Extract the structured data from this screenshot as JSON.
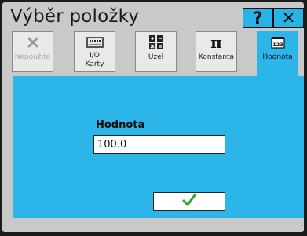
{
  "window": {
    "title": "Výběr položky",
    "help_label": "?",
    "close_label": "✕"
  },
  "tabs": [
    {
      "label": "Nepoužito",
      "icon": "x-icon",
      "state": "disabled"
    },
    {
      "label": "I/O\nKarty",
      "icon": "io-card-icon",
      "state": "normal"
    },
    {
      "label": "Uzel",
      "icon": "node-grid-icon",
      "state": "normal"
    },
    {
      "label": "Konstanta",
      "icon": "pi-icon",
      "state": "normal"
    },
    {
      "label": "Hodnota",
      "icon": "number-123-icon",
      "state": "active"
    }
  ],
  "form": {
    "value_label": "Hodnota",
    "value": "100.0",
    "ok_icon": "checkmark-icon"
  },
  "colors": {
    "accent": "#2bb5e8",
    "check": "#2fa82f"
  }
}
